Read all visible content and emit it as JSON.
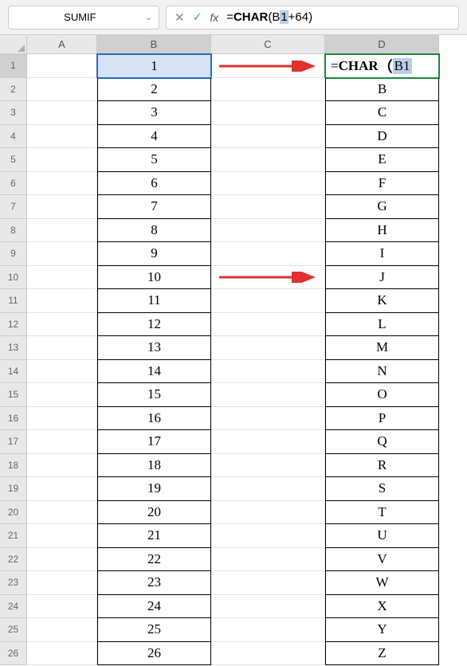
{
  "nameBox": "SUMIF",
  "formulaBar": {
    "prefix": "=",
    "fn": "CHAR",
    "open": "(",
    "refPre": "B",
    "refHighlight": "1",
    "suffix": "+64)"
  },
  "columns": [
    "A",
    "B",
    "C",
    "D"
  ],
  "rows": [
    {
      "n": "1",
      "b": "1",
      "d_formula": {
        "eq": "=",
        "fn": "CHAR",
        "open": "（",
        "ref": "B1"
      }
    },
    {
      "n": "2",
      "b": "2",
      "d": "B"
    },
    {
      "n": "3",
      "b": "3",
      "d": "C"
    },
    {
      "n": "4",
      "b": "4",
      "d": "D"
    },
    {
      "n": "5",
      "b": "5",
      "d": "E"
    },
    {
      "n": "6",
      "b": "6",
      "d": "F"
    },
    {
      "n": "7",
      "b": "7",
      "d": "G"
    },
    {
      "n": "8",
      "b": "8",
      "d": "H"
    },
    {
      "n": "9",
      "b": "9",
      "d": "I"
    },
    {
      "n": "10",
      "b": "10",
      "d": "J"
    },
    {
      "n": "11",
      "b": "11",
      "d": "K"
    },
    {
      "n": "12",
      "b": "12",
      "d": "L"
    },
    {
      "n": "13",
      "b": "13",
      "d": "M"
    },
    {
      "n": "14",
      "b": "14",
      "d": "N"
    },
    {
      "n": "15",
      "b": "15",
      "d": "O"
    },
    {
      "n": "16",
      "b": "16",
      "d": "P"
    },
    {
      "n": "17",
      "b": "17",
      "d": "Q"
    },
    {
      "n": "18",
      "b": "18",
      "d": "R"
    },
    {
      "n": "19",
      "b": "19",
      "d": "S"
    },
    {
      "n": "20",
      "b": "20",
      "d": "T"
    },
    {
      "n": "21",
      "b": "21",
      "d": "U"
    },
    {
      "n": "22",
      "b": "22",
      "d": "V"
    },
    {
      "n": "23",
      "b": "23",
      "d": "W"
    },
    {
      "n": "24",
      "b": "24",
      "d": "X"
    },
    {
      "n": "25",
      "b": "25",
      "d": "Y"
    },
    {
      "n": "26",
      "b": "26",
      "d": "Z"
    }
  ]
}
